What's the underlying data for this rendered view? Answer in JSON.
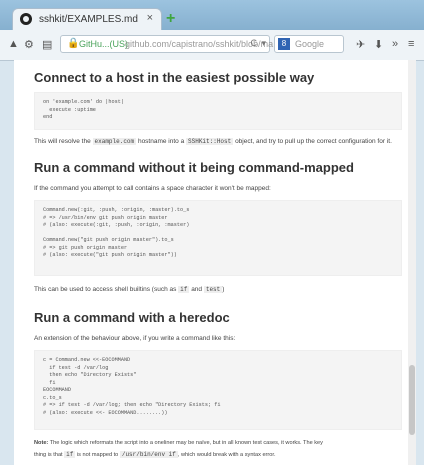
{
  "browser": {
    "tab_title": "sshkit/EXAMPLES.md at ...",
    "tab_close": "×",
    "new_tab": "+",
    "url_host": "GitHu...(US)",
    "url_path": "github.com/capistrano/sshkit/blob/ma",
    "search_engine": "Google",
    "icons": [
      "back-icon",
      "lock-icon",
      "reader-icon",
      "reload-icon",
      "bookmarks-icon",
      "download-icon",
      "overflow-icon",
      "menu-icon"
    ]
  },
  "doc": {
    "h1": "Connect to a host in the easiest possible way",
    "code1": [
      "on 'example.com' do |host|",
      "  execute :uptime",
      "end"
    ],
    "p1_a": "This will resolve the",
    "p1_code1": "example.com",
    "p1_b": "hostname into a",
    "p1_code2": "SSHKit::Host",
    "p1_c": "object, and try to pull up the correct configuration for it.",
    "h2": "Run a command without it being command-mapped",
    "p2": "If the command you attempt to call contains a space character it won't be mapped:",
    "code2": [
      "Command.new(:git, :push, :origin, :master).to_s",
      "# => /usr/bin/env git push origin master",
      "# (also: execute(:git, :push, :origin, :master)",
      "",
      "Command.new(\"git push origin master\").to_s",
      "# => git push origin master",
      "# (also: execute(\"git push origin master\"))"
    ],
    "p3_a": "This can be used to access shell builtins (such as",
    "p3_code1": "if",
    "p3_b": "and",
    "p3_code2": "test",
    "p3_c": ")",
    "h3": "Run a command with a heredoc",
    "p4": "An extension of the behaviour above, if you write a command like this:",
    "code3": [
      "c = Command.new <<-EOCOMMAND",
      "  if test -d /var/log",
      "  then echo \"Directory Exists\"",
      "  fi",
      "EOCOMMAND",
      "c.to_s",
      "# => if test -d /var/log; then echo \"Directory Exists; fi",
      "# (also: execute <<- EOCOMMAND........))"
    ],
    "note_label": "Note:",
    "note_a": "The logic which reformats the script into a oneliner may be naïve, but in all known test cases, it works. The key",
    "note_b": "thing is that",
    "note_code1": "if",
    "note_c": "is not mapped to",
    "note_code2": "/usr/bin/env if",
    "note_d": ", which would break with a syntax error."
  }
}
